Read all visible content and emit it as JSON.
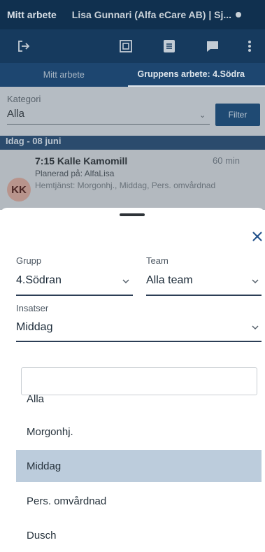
{
  "topbar": {
    "title": "Mitt arbete",
    "user": "Lisa Gunnari (Alfa eCare AB) | Sj..."
  },
  "toolbar": {
    "icons": [
      "logout-icon",
      "schedule-icon",
      "list-icon",
      "chat-icon",
      "more-icon"
    ]
  },
  "tabs": {
    "mine": "Mitt arbete",
    "group": "Gruppens arbete: 4.Södra"
  },
  "filterbar": {
    "kategori_label": "Kategori",
    "kategori_value": "Alla",
    "filter_button": "Filter"
  },
  "day_header": "Idag - 08 juni",
  "visit": {
    "initials": "KK",
    "title": "7:15 Kalle Kamomill",
    "duration": "60 min",
    "planned": "Planerad på: AlfaLisa",
    "services": "Hemtjänst: Morgonhj., Middag, Pers. omvårdnad"
  },
  "sheet": {
    "grupp_label": "Grupp",
    "grupp_value": "4.Södran",
    "team_label": "Team",
    "team_value": "Alla team",
    "insatser_label": "Insatser",
    "insatser_value": "Middag",
    "search_placeholder": "",
    "options": [
      "Alla",
      "Morgonhj.",
      "Middag",
      "Pers. omvårdnad",
      "Dusch"
    ],
    "selected_option": "Middag"
  },
  "colors": {
    "nav_dark": "#10304f",
    "nav_mid": "#163a5e",
    "selected_option_bg": "#bcccdc",
    "field_underline": "#2c3e56",
    "close_icon": "#1f4f8a"
  }
}
